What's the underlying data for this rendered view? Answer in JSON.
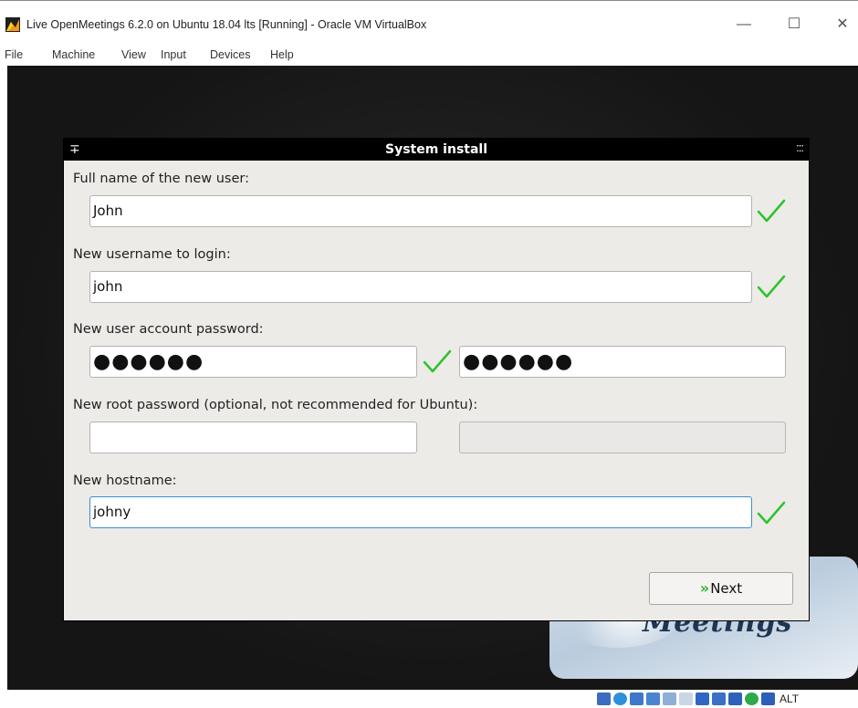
{
  "window": {
    "title": "Live OpenMeetings 6.2.0 on Ubuntu 18.04 lts [Running] - Oracle VM VirtualBox",
    "minimize_glyph": "—",
    "maximize_glyph": "☐",
    "close_glyph": "✕"
  },
  "menu": [
    "File",
    "Machine",
    "View",
    "Input",
    "Devices",
    "Help"
  ],
  "dialog": {
    "title": "System install",
    "pin_glyph": "∓",
    "menu_glyph": ":::",
    "full_name_label": "Full name of the new user:",
    "full_name_value": "John",
    "username_label": "New username to login:",
    "username_value": "john",
    "password_label": "New user account password:",
    "password_value": "●●●●●●",
    "password_confirm_value": "●●●●●●",
    "root_password_label": "New root password (optional, not recommended for Ubuntu):",
    "root_password_value": "",
    "root_password_confirm_value": "",
    "hostname_label": "New hostname:",
    "hostname_value": "johny",
    "next_arrow": "»",
    "next_label": "Next"
  },
  "background_logo": {
    "text": "Meetings"
  },
  "statusbar": {
    "host_key": "ALT"
  },
  "colors": {
    "check_green": "#2dc22d",
    "dialog_bg": "#edebe8",
    "titlebar_bg": "#000000",
    "focus_border": "#3b8ed1"
  }
}
